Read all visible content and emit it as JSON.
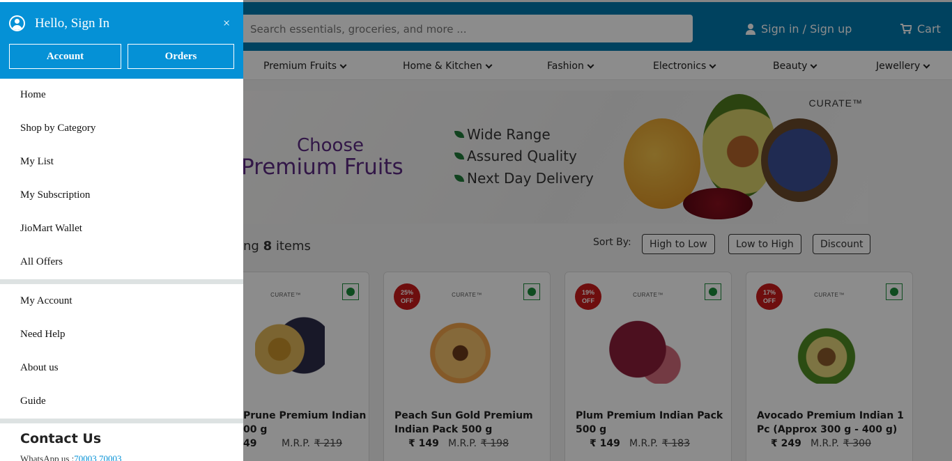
{
  "header": {
    "search_placeholder": "Search essentials, groceries, and more ...",
    "signin_label": "Sign in / Sign up",
    "cart_label": "Cart"
  },
  "nav": {
    "categories": [
      "Premium Fruits",
      "Home & Kitchen",
      "Fashion",
      "Electronics",
      "Beauty",
      "Jewellery"
    ]
  },
  "banner": {
    "brand": "CURATE™",
    "line1": "Choose",
    "line2": "Premium Fruits",
    "features": [
      "Wide Range",
      "Assured Quality",
      "Next Day Delivery"
    ]
  },
  "listing": {
    "showing_prefix": "ng",
    "count": "8",
    "showing_suffix": "items",
    "sort_label": "Sort By:",
    "sort_options": [
      "High to Low",
      "Low to High",
      "Discount"
    ]
  },
  "products": [
    {
      "brand": "CURATE™",
      "name": "Prune Premium Indian",
      "name2": "00 g",
      "price": "49",
      "mrp_label": "M.R.P.",
      "mrp": "₹ 219",
      "discount": ""
    },
    {
      "brand": "CURATE™",
      "name": "Peach Sun Gold Premium",
      "name2": "Indian Pack 500 g",
      "price": "₹ 149",
      "mrp_label": "M.R.P.",
      "mrp": "₹ 198",
      "discount": "25%",
      "discount_label": "OFF"
    },
    {
      "brand": "CURATE™",
      "name": "Plum Premium Indian Pack",
      "name2": "500 g",
      "price": "₹ 149",
      "mrp_label": "M.R.P.",
      "mrp": "₹ 183",
      "discount": "19%",
      "discount_label": "OFF"
    },
    {
      "brand": "CURATE™",
      "name": "Avocado Premium Indian 1",
      "name2": "Pc (Approx 300 g - 400 g)",
      "price": "₹ 249",
      "mrp_label": "M.R.P.",
      "mrp": "₹ 300",
      "discount": "17%",
      "discount_label": "OFF"
    }
  ],
  "drawer": {
    "greeting": "Hello, Sign In",
    "close_glyph": "×",
    "account_button": "Account",
    "orders_button": "Orders",
    "menu_primary": [
      "Home",
      "Shop by Category",
      "My List",
      "My Subscription",
      "JioMart Wallet",
      "All Offers"
    ],
    "menu_secondary": [
      "My Account",
      "Need Help",
      "About us",
      "Guide"
    ],
    "contact_title": "Contact Us",
    "whatsapp_label": "WhatsApp us :",
    "whatsapp_number": "70003 70003"
  },
  "colors": {
    "drawer_header": "#0591d6",
    "topbar": "#0078ad",
    "discount_badge": "#c81a1a",
    "veg_mark": "#1a8a3a"
  }
}
